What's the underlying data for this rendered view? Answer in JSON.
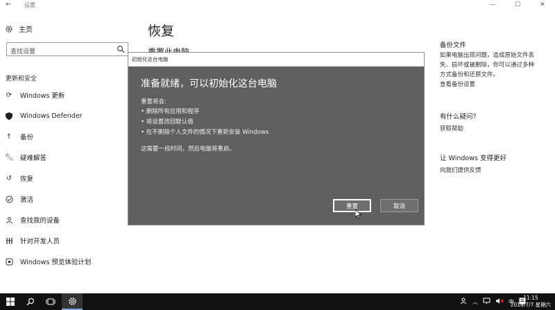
{
  "window": {
    "title": "设置",
    "controls": [
      "—",
      "☐",
      "✕"
    ]
  },
  "nav": {
    "home_label": "主页",
    "search_placeholder": "查找设置",
    "section_title": "更新和安全",
    "items": [
      {
        "label": "Windows 更新",
        "icon": "refresh-icon"
      },
      {
        "label": "Windows Defender",
        "icon": "shield-icon"
      },
      {
        "label": "备份",
        "icon": "upload-icon"
      },
      {
        "label": "疑难解答",
        "icon": "wrench-icon"
      },
      {
        "label": "恢复",
        "icon": "history-icon"
      },
      {
        "label": "激活",
        "icon": "check-circle-icon"
      },
      {
        "label": "查找我的设备",
        "icon": "person-pin-icon"
      },
      {
        "label": "针对开发人员",
        "icon": "developer-icon"
      },
      {
        "label": "Windows 预览体验计划",
        "icon": "insider-icon"
      }
    ]
  },
  "main": {
    "page_title": "恢复",
    "section_heading": "重置此电脑"
  },
  "right": {
    "backup_heading": "备份文件",
    "backup_text_lines": [
      "如果电脑出现问题，造成原始文件丢",
      "失、损坏或被删除，你可以通过多种",
      "方式备份和还原文件。"
    ],
    "backup_link": "查看备份设置",
    "question_heading": "有什么疑问?",
    "help_link": "获取帮助",
    "improve_heading": "让 Windows 变得更好",
    "feedback_link": "向我们提供反馈"
  },
  "dialog": {
    "title": "初始化这台电脑",
    "heading": "准备就绪，可以初始化这台电脑",
    "intro": "重置将会:",
    "bullets": [
      "删除所有应用和程序",
      "将设置改回默认值",
      "在不删除个人文件的情况下重新安装 Windows"
    ],
    "note": "这需要一段时间，然后电脑将重启。",
    "reset_button": "重置",
    "cancel_button": "取消"
  },
  "taskbar": {
    "ime_indicator": "中",
    "time": "11:15",
    "date": "2018/7/7 星期六"
  },
  "colors": {
    "dialog_bg": "#5f5f5f",
    "taskbar_bg": "#111111",
    "page_bg": "#ffffff"
  }
}
